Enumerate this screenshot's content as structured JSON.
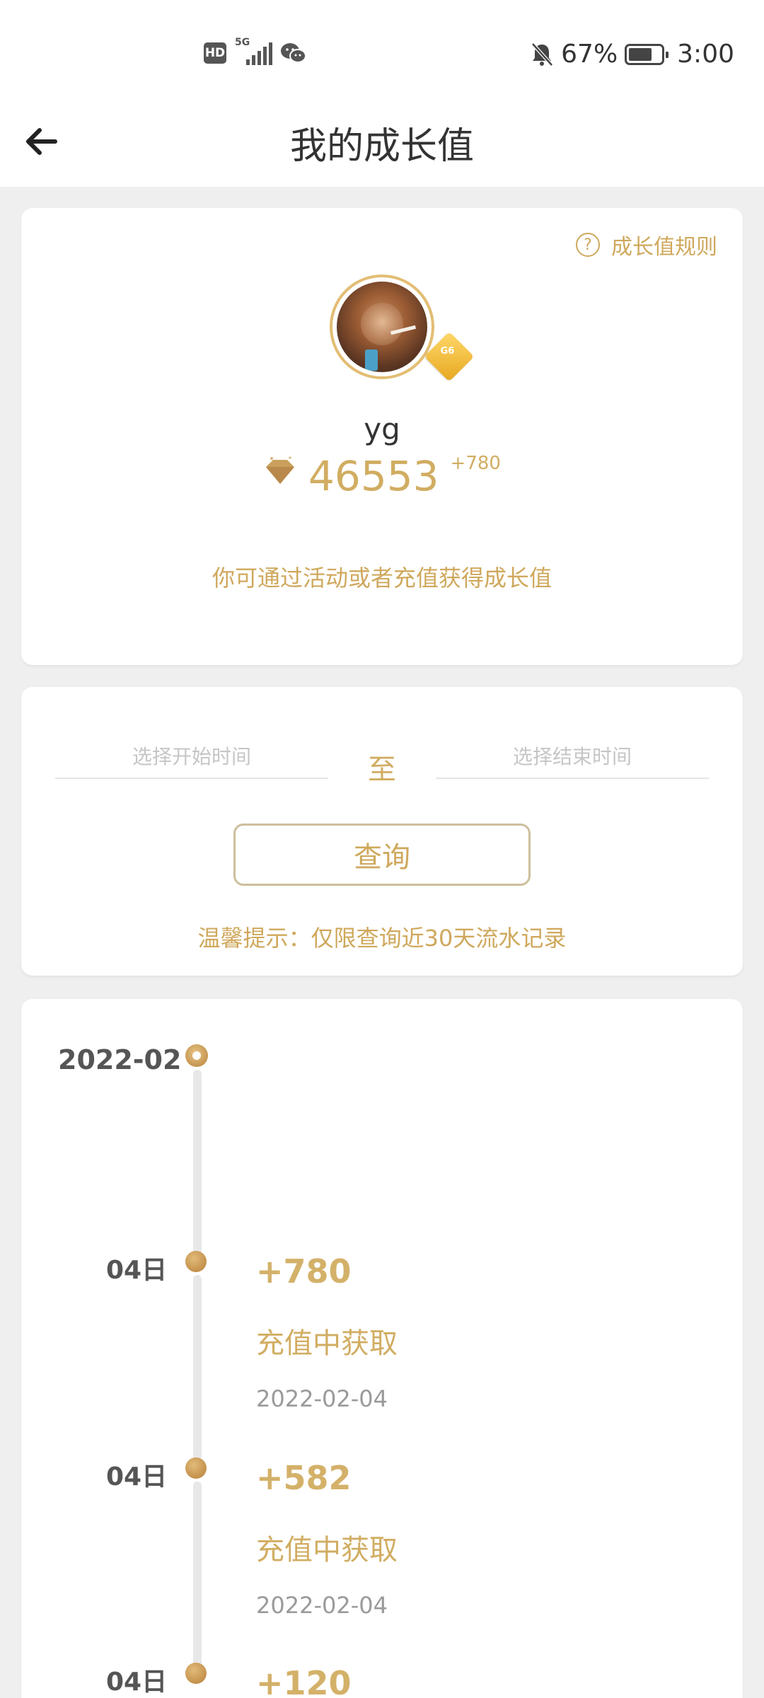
{
  "status_bar": {
    "hd": "HD",
    "network": "5G",
    "battery_percent": "67%",
    "time": "3:00"
  },
  "nav": {
    "title": "我的成长值"
  },
  "profile": {
    "rules_label": "成长值规则",
    "username": "yg",
    "points": "46553",
    "points_delta": "+780",
    "hint": "你可通过活动或者充值获得成长值"
  },
  "query": {
    "start_placeholder": "选择开始时间",
    "to_label": "至",
    "end_placeholder": "选择结束时间",
    "button_label": "查询",
    "hint": "温馨提示：仅限查询近30天流水记录"
  },
  "timeline": {
    "month": "2022-02",
    "records": [
      {
        "day": "04日",
        "amount": "+780",
        "source": "充值中获取",
        "date": "2022-02-04"
      },
      {
        "day": "04日",
        "amount": "+582",
        "source": "充值中获取",
        "date": "2022-02-04"
      },
      {
        "day": "04日",
        "amount": "+120"
      }
    ]
  },
  "colors": {
    "accent_gold": "#d1ad62",
    "background": "#efefef"
  }
}
